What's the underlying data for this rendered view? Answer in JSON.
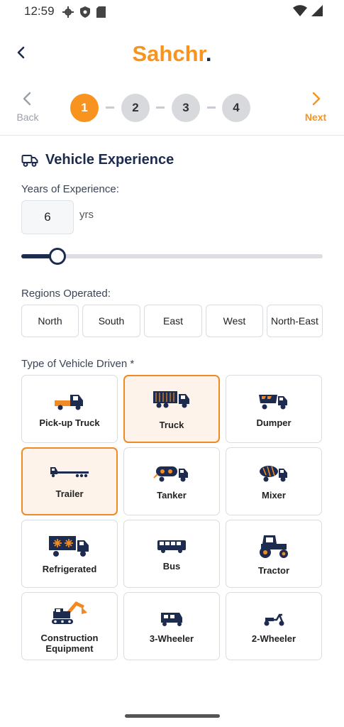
{
  "status_bar": {
    "time": "12:59"
  },
  "header": {
    "logo_text": "Sahchr",
    "logo_dot": "."
  },
  "stepper": {
    "back_label": "Back",
    "next_label": "Next",
    "steps": [
      "1",
      "2",
      "3",
      "4"
    ],
    "active_step": 1
  },
  "section": {
    "title": "Vehicle Experience"
  },
  "experience": {
    "label": "Years of Experience:",
    "value": "6",
    "unit": "yrs",
    "slider_fraction": 0.12
  },
  "regions": {
    "label": "Regions Operated:",
    "options": [
      {
        "label": "North",
        "selected": true
      },
      {
        "label": "South",
        "selected": false
      },
      {
        "label": "East",
        "selected": true
      },
      {
        "label": "West",
        "selected": false
      },
      {
        "label": "North-East",
        "selected": false
      }
    ]
  },
  "vehicles": {
    "label": "Type of Vehicle Driven *",
    "items": [
      {
        "label": "Pick-up Truck",
        "icon": "pickup-truck-icon",
        "selected": false
      },
      {
        "label": "Truck",
        "icon": "truck-icon",
        "selected": true
      },
      {
        "label": "Dumper",
        "icon": "dumper-icon",
        "selected": false
      },
      {
        "label": "Trailer",
        "icon": "trailer-icon",
        "selected": true
      },
      {
        "label": "Tanker",
        "icon": "tanker-icon",
        "selected": false
      },
      {
        "label": "Mixer",
        "icon": "mixer-icon",
        "selected": false
      },
      {
        "label": "Refrigerated",
        "icon": "refrigerated-truck-icon",
        "selected": false
      },
      {
        "label": "Bus",
        "icon": "bus-icon",
        "selected": false
      },
      {
        "label": "Tractor",
        "icon": "tractor-icon",
        "selected": false
      },
      {
        "label": "Construction Equipment",
        "icon": "excavator-icon",
        "selected": false
      },
      {
        "label": "3-Wheeler",
        "icon": "three-wheeler-icon",
        "selected": false
      },
      {
        "label": "2-Wheeler",
        "icon": "scooter-icon",
        "selected": false
      }
    ]
  },
  "colors": {
    "accent": "#f7931e",
    "navy": "#1d2b4f",
    "selected_bg": "#fdf3ea"
  }
}
